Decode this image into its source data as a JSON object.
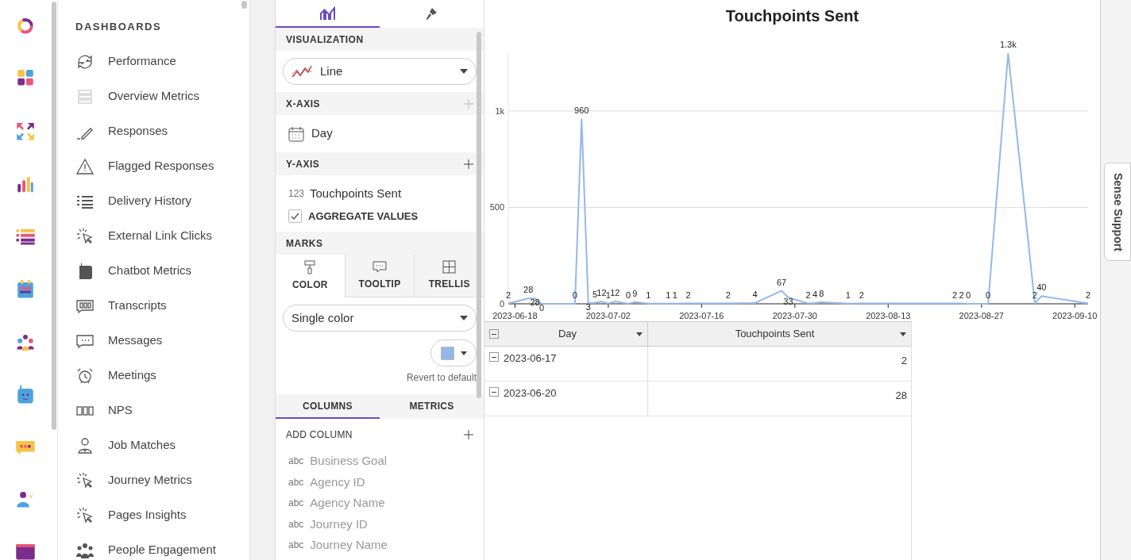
{
  "nav": {
    "heading": "DASHBOARDS",
    "items": [
      {
        "label": "Performance"
      },
      {
        "label": "Overview Metrics"
      },
      {
        "label": "Responses"
      },
      {
        "label": "Flagged Responses"
      },
      {
        "label": "Delivery History"
      },
      {
        "label": "External Link Clicks"
      },
      {
        "label": "Chatbot Metrics"
      },
      {
        "label": "Transcripts"
      },
      {
        "label": "Messages"
      },
      {
        "label": "Meetings"
      },
      {
        "label": "NPS"
      },
      {
        "label": "Job Matches"
      },
      {
        "label": "Journey Metrics"
      },
      {
        "label": "Pages Insights"
      },
      {
        "label": "People Engagement"
      }
    ]
  },
  "panel": {
    "tabs": [
      {
        "selected": true
      },
      {
        "selected": false
      }
    ],
    "visualization": {
      "heading": "VISUALIZATION",
      "value": "Line"
    },
    "x_axis": {
      "heading": "X-AXIS",
      "field": "Day"
    },
    "y_axis": {
      "heading": "Y-AXIS",
      "type_tag": "123",
      "field": "Touchpoints Sent",
      "aggregate_label": "AGGREGATE VALUES",
      "aggregate_checked": true
    },
    "marks": {
      "heading": "MARKS",
      "tabs": [
        {
          "label": "COLOR",
          "selected": true
        },
        {
          "label": "TOOLTIP",
          "selected": false
        },
        {
          "label": "TRELLIS",
          "selected": false
        }
      ],
      "color_mode": "Single color",
      "revert": "Revert to default"
    },
    "bottom_tabs": [
      {
        "label": "COLUMNS",
        "selected": true
      },
      {
        "label": "METRICS",
        "selected": false
      }
    ],
    "add_column": "ADD COLUMN",
    "columns": [
      {
        "type_tag": "abc",
        "name": "Business Goal"
      },
      {
        "type_tag": "abc",
        "name": "Agency ID"
      },
      {
        "type_tag": "abc",
        "name": "Agency Name"
      },
      {
        "type_tag": "abc",
        "name": "Journey ID"
      },
      {
        "type_tag": "abc",
        "name": "Journey Name"
      }
    ]
  },
  "chart": {
    "chart_data": {
      "type": "line",
      "title": "Touchpoints Sent",
      "categories": [
        null,
        "2023-06-18",
        null,
        null,
        null,
        null,
        null,
        null,
        null,
        null,
        null,
        null,
        null,
        null,
        null,
        "2023-07-02",
        null,
        null,
        null,
        null,
        null,
        null,
        null,
        null,
        null,
        null,
        null,
        null,
        null,
        "2023-07-16",
        null,
        null,
        null,
        null,
        null,
        null,
        null,
        null,
        null,
        null,
        null,
        null,
        null,
        "2023-07-30",
        null,
        null,
        null,
        null,
        null,
        null,
        null,
        null,
        null,
        null,
        null,
        null,
        null,
        "2023-08-13",
        null,
        null,
        null,
        null,
        null,
        null,
        null,
        null,
        null,
        null,
        null,
        null,
        null,
        "2023-08-27",
        null,
        null,
        null,
        null,
        null,
        null,
        null,
        null,
        null,
        null,
        null,
        null,
        null,
        "2023-09-10",
        null,
        null
      ],
      "series": [
        {
          "color": "#93b8ea",
          "values": [
            2,
            null,
            null,
            28,
            28,
            0,
            null,
            null,
            null,
            null,
            0,
            960,
            3,
            5,
            12,
            1,
            12,
            null,
            0,
            9,
            null,
            1,
            null,
            null,
            1,
            1,
            null,
            2,
            null,
            null,
            null,
            null,
            null,
            2,
            null,
            null,
            null,
            4,
            null,
            null,
            null,
            67,
            33,
            null,
            null,
            2,
            4,
            8,
            null,
            null,
            null,
            1,
            null,
            2,
            null,
            null,
            null,
            null,
            null,
            null,
            null,
            null,
            null,
            null,
            null,
            null,
            null,
            2,
            2,
            0,
            null,
            null,
            0,
            null,
            null,
            1300,
            null,
            null,
            null,
            2,
            40,
            null,
            null,
            null,
            null,
            null,
            null,
            2
          ]
        }
      ],
      "value_labels": [
        "2",
        null,
        null,
        "28",
        "28",
        "0",
        null,
        null,
        null,
        null,
        "0",
        "960",
        "3",
        "5",
        "12",
        "1",
        "12",
        null,
        "0",
        "9",
        null,
        "1",
        null,
        null,
        "1",
        "1",
        null,
        "2",
        null,
        null,
        null,
        null,
        null,
        "2",
        null,
        null,
        null,
        "4",
        null,
        null,
        null,
        "67",
        "33",
        null,
        null,
        "2",
        "4",
        "8",
        null,
        null,
        null,
        "1",
        null,
        "2",
        null,
        null,
        null,
        null,
        null,
        null,
        null,
        null,
        null,
        null,
        null,
        null,
        null,
        "2",
        "2",
        "0",
        null,
        null,
        "0",
        null,
        null,
        "1.3k",
        null,
        null,
        null,
        "2",
        "40",
        null,
        null,
        null,
        null,
        null,
        null,
        "2"
      ],
      "ylim": [
        0,
        1300
      ],
      "yticks": [
        0,
        500,
        {
          "value": 1000,
          "label": "1k"
        }
      ]
    }
  },
  "table": {
    "columns": [
      "Day",
      "Touchpoints Sent"
    ],
    "rows": [
      [
        "2023-06-17",
        "2"
      ],
      [
        "2023-06-20",
        "28"
      ]
    ]
  },
  "support_tab": "Sense Support"
}
